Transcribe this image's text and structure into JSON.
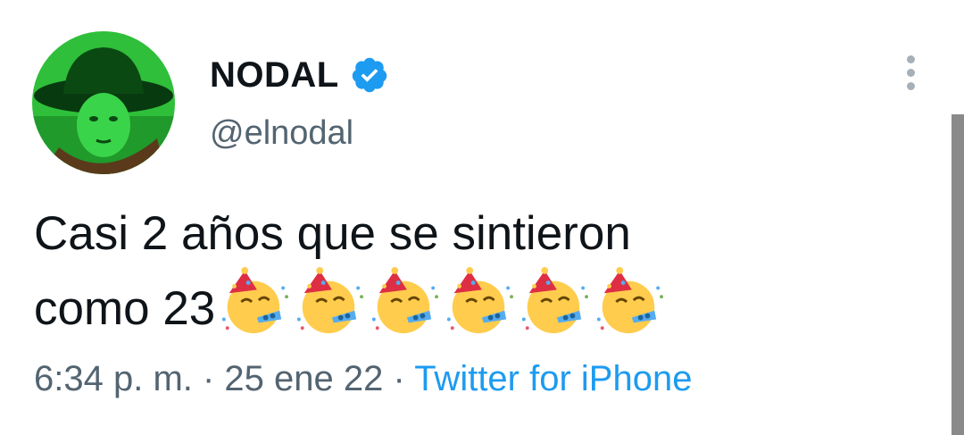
{
  "author": {
    "display_name": "NODAL",
    "handle": "@elnodal",
    "verified": true,
    "avatar": "avatar-photo"
  },
  "tweet": {
    "text_line1": "Casi 2 años que se sintieron",
    "text_line2": "como 23",
    "emojis": [
      "partying-face",
      "partying-face",
      "partying-face",
      "partying-face",
      "partying-face",
      "partying-face"
    ]
  },
  "meta": {
    "time": "6:34 p. m.",
    "separator1": " · ",
    "date": "25 ene 22",
    "separator2": " · ",
    "source": "Twitter for iPhone"
  },
  "colors": {
    "text": "#0f1419",
    "secondary": "#536471",
    "link": "#1d9bf0",
    "verified": "#1d9bf0"
  },
  "icons": {
    "more": "more-vertical-icon",
    "verified": "verified-badge-icon"
  }
}
